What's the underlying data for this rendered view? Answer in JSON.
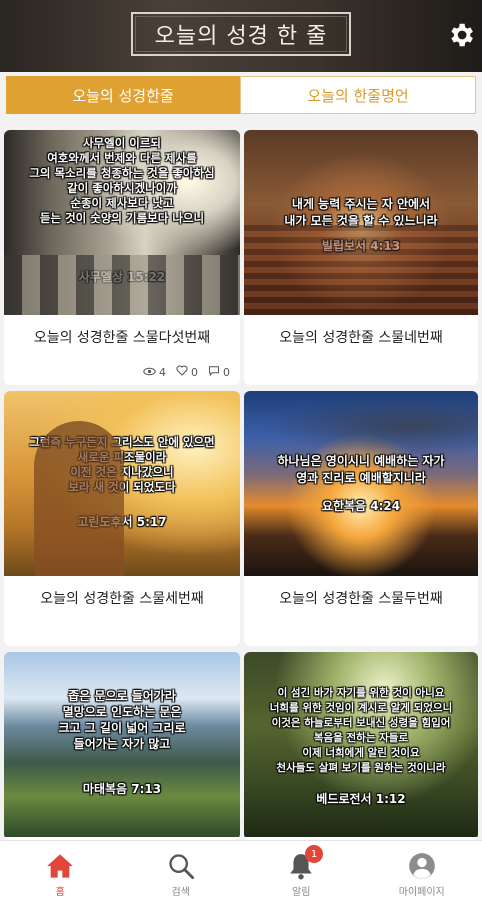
{
  "header": {
    "title": "오늘의 성경 한 줄",
    "settings_icon": "gear-icon"
  },
  "tabs": [
    {
      "label": "오늘의 성경한줄",
      "active": true
    },
    {
      "label": "오늘의 한줄명언",
      "active": false
    }
  ],
  "cards": [
    {
      "title": "오늘의 성경한줄 스물다섯번째",
      "verse": "사무엘이 이르되\n여호와께서 번제와 다른 제사를\n그의 목소리를 청종하는 것을 좋아하심\n같이 좋아하시겠나이까\n순종이 제사보다 낫고\n듣는 것이 숫양의 기름보다 나으니",
      "reference": "사무엘상 15:22",
      "views": "4",
      "likes": "0",
      "comments": "0"
    },
    {
      "title": "오늘의 성경한줄 스물네번째",
      "verse": "내게 능력 주시는 자 안에서\n내가 모든 것을 할 수 있느니라",
      "reference": "빌립보서 4:13"
    },
    {
      "title": "오늘의 성경한줄 스물세번째",
      "verse": "그런즉 누구든지 그리스도 안에 있으면\n새로운 피조물이라\n이전 것은 지나갔으니\n보라 새 것이 되었도다",
      "reference": "고린도후서 5:17"
    },
    {
      "title": "오늘의 성경한줄 스물두번째",
      "verse": "하나님은 영이시니 예배하는 자가\n영과 진리로 예배할지니라",
      "reference": "요한복음 4:24"
    },
    {
      "title": "",
      "verse": "좁은 문으로 들어가라\n멸망으로 인도하는 문은\n크고 그 길이 넓어 그리로\n들어가는 자가 많고",
      "reference": "마태복음 7:13"
    },
    {
      "title": "",
      "verse": "이 섬긴 바가 자기를 위한 것이 아니요\n너희를 위한 것임이 계시로 알게 되었으니\n이것은 하늘로부터 보내신 성령을 힘입어\n복음을 전하는 자들로\n이제 너희에게 알린 것이요\n천사들도 살펴 보기를 원하는 것이니라",
      "reference": "베드로전서 1:12"
    }
  ],
  "bottom_nav": [
    {
      "label": "홈",
      "icon": "home-icon",
      "active": true
    },
    {
      "label": "검색",
      "icon": "search-icon",
      "active": false
    },
    {
      "label": "알림",
      "icon": "bell-icon",
      "active": false,
      "badge": "1"
    },
    {
      "label": "마이페이지",
      "icon": "user-icon",
      "active": false
    }
  ],
  "colors": {
    "accent": "#e0a133",
    "active_nav": "#e2463a"
  }
}
